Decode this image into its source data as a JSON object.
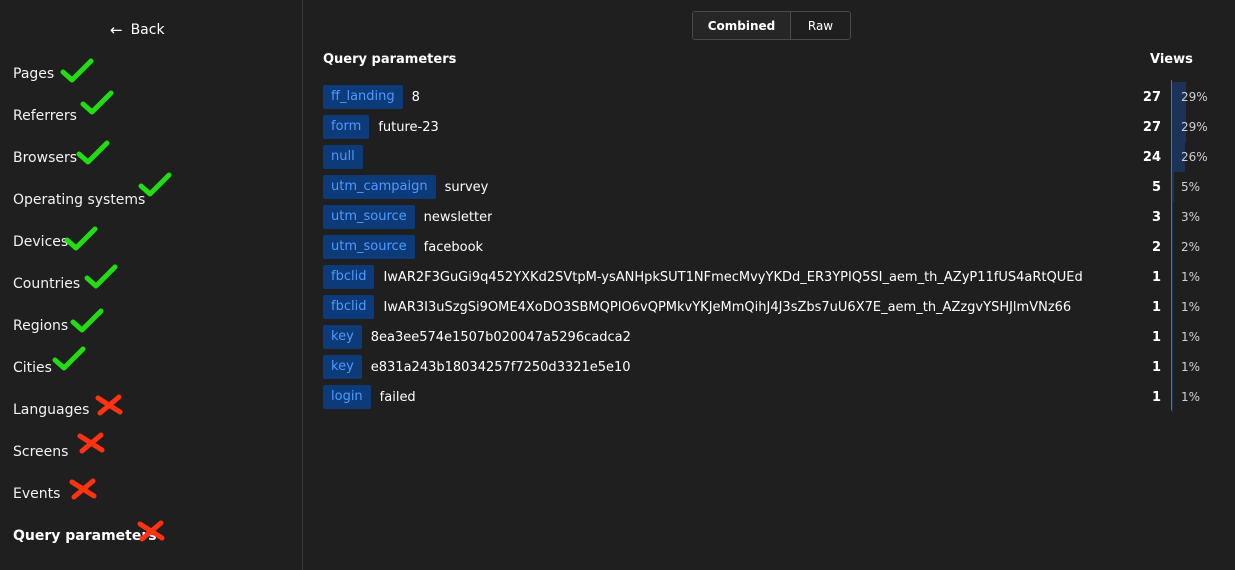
{
  "sidebar": {
    "back_label": "Back",
    "items": [
      {
        "label": "Pages",
        "status": "check"
      },
      {
        "label": "Referrers",
        "status": "check"
      },
      {
        "label": "Browsers",
        "status": "check"
      },
      {
        "label": "Operating systems",
        "status": "check"
      },
      {
        "label": "Devices",
        "status": "check"
      },
      {
        "label": "Countries",
        "status": "check"
      },
      {
        "label": "Regions",
        "status": "check"
      },
      {
        "label": "Cities",
        "status": "check"
      },
      {
        "label": "Languages",
        "status": "cross"
      },
      {
        "label": "Screens",
        "status": "cross"
      },
      {
        "label": "Events",
        "status": "cross"
      },
      {
        "label": "Query parameters",
        "status": "cross",
        "active": true
      }
    ]
  },
  "toggle": {
    "combined": "Combined",
    "raw": "Raw",
    "selected": "Combined"
  },
  "table": {
    "header_left": "Query parameters",
    "header_right": "Views",
    "rows": [
      {
        "key": "ff_landing",
        "value": "8",
        "views": "27",
        "percent": "29%",
        "share": 0.29
      },
      {
        "key": "form",
        "value": "future-23",
        "views": "27",
        "percent": "29%",
        "share": 0.29
      },
      {
        "key": "null",
        "value": "",
        "views": "24",
        "percent": "26%",
        "share": 0.26
      },
      {
        "key": "utm_campaign",
        "value": "survey",
        "views": "5",
        "percent": "5%",
        "share": 0.05
      },
      {
        "key": "utm_source",
        "value": "newsletter",
        "views": "3",
        "percent": "3%",
        "share": 0.03
      },
      {
        "key": "utm_source",
        "value": "facebook",
        "views": "2",
        "percent": "2%",
        "share": 0.02
      },
      {
        "key": "fbclid",
        "value": "IwAR2F3GuGi9q452YXKd2SVtpM-ysANHpkSUT1NFmecMvyYKDd_ER3YPIQ5SI_aem_th_AZyP11fUS4aRtQUEd",
        "views": "1",
        "percent": "1%",
        "share": 0.01
      },
      {
        "key": "fbclid",
        "value": "IwAR3I3uSzgSi9OME4XoDO3SBMQPIO6vQPMkvYKJeMmQihJ4J3sZbs7uU6X7E_aem_th_AZzgvYSHJlmVNz66",
        "views": "1",
        "percent": "1%",
        "share": 0.01
      },
      {
        "key": "key",
        "value": "8ea3ee574e1507b020047a5296cadca2",
        "views": "1",
        "percent": "1%",
        "share": 0.01
      },
      {
        "key": "key",
        "value": "e831a243b18034257f7250d3321e5e10",
        "views": "1",
        "percent": "1%",
        "share": 0.01
      },
      {
        "key": "login",
        "value": "failed",
        "views": "1",
        "percent": "1%",
        "share": 0.01
      }
    ]
  },
  "colors": {
    "check": "#22dd11",
    "cross": "#ff3311",
    "key_bg": "#0d3a78",
    "key_text": "#4d9bff",
    "bar": "#1b3358"
  },
  "icons": {
    "back": "arrow-left-icon",
    "check": "check-mark-icon",
    "cross": "cross-mark-icon"
  }
}
